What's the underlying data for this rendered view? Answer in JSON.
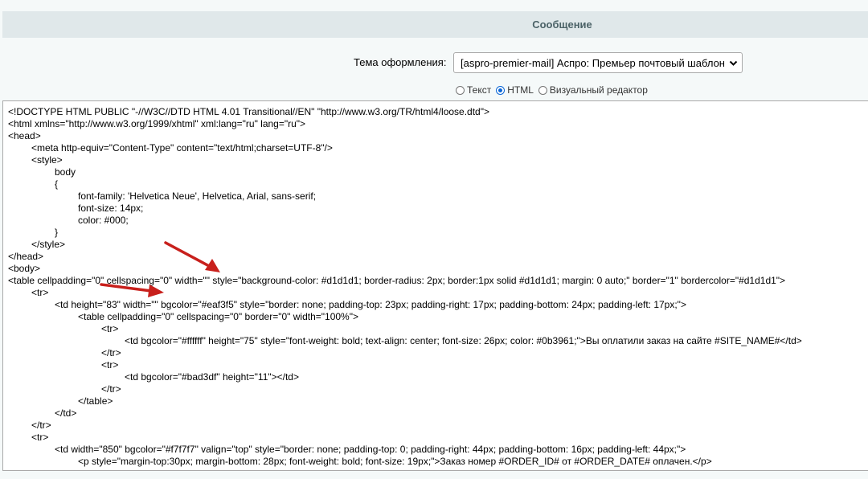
{
  "header": {
    "title": "Сообщение"
  },
  "theme": {
    "label": "Тема оформления:",
    "selected": "[aspro-premier-mail] Аспро: Премьер почтовый шаблон"
  },
  "modes": [
    {
      "label": "Текст",
      "checked": false
    },
    {
      "label": "HTML",
      "checked": true
    },
    {
      "label": "Визуальный редактор",
      "checked": false
    }
  ],
  "editor": {
    "lines": [
      "<!DOCTYPE HTML PUBLIC \"-//W3C//DTD HTML 4.01 Transitional//EN\" \"http://www.w3.org/TR/html4/loose.dtd\">",
      "<html xmlns=\"http://www.w3.org/1999/xhtml\" xml:lang=\"ru\" lang=\"ru\">",
      "<head>",
      "\t<meta http-equiv=\"Content-Type\" content=\"text/html;charset=UTF-8\"/>",
      "\t<style>",
      "\t\tbody",
      "\t\t{",
      "\t\t\tfont-family: 'Helvetica Neue', Helvetica, Arial, sans-serif;",
      "\t\t\tfont-size: 14px;",
      "\t\t\tcolor: #000;",
      "\t\t}",
      "\t</style>",
      "</head>",
      "<body>",
      "<table cellpadding=\"0\" cellspacing=\"0\" width=\"\" style=\"background-color: #d1d1d1; border-radius: 2px; border:1px solid #d1d1d1; margin: 0 auto;\" border=\"1\" bordercolor=\"#d1d1d1\">",
      "\t<tr>",
      "\t\t<td height=\"83\" width=\"\" bgcolor=\"#eaf3f5\" style=\"border: none; padding-top: 23px; padding-right: 17px; padding-bottom: 24px; padding-left: 17px;\">",
      "\t\t\t<table cellpadding=\"0\" cellspacing=\"0\" border=\"0\" width=\"100%\">",
      "\t\t\t\t<tr>",
      "\t\t\t\t\t<td bgcolor=\"#ffffff\" height=\"75\" style=\"font-weight: bold; text-align: center; font-size: 26px; color: #0b3961;\">Вы оплатили заказ на сайте #SITE_NAME#</td>",
      "\t\t\t\t</tr>",
      "\t\t\t\t<tr>",
      "\t\t\t\t\t<td bgcolor=\"#bad3df\" height=\"11\"></td>",
      "\t\t\t\t</tr>",
      "\t\t\t</table>",
      "\t\t</td>",
      "\t</tr>",
      "\t<tr>",
      "\t\t<td width=\"850\" bgcolor=\"#f7f7f7\" valign=\"top\" style=\"border: none; padding-top: 0; padding-right: 44px; padding-bottom: 16px; padding-left: 44px;\">",
      "\t\t\t<p style=\"margin-top:30px; margin-bottom: 28px; font-weight: bold; font-size: 19px;\">Заказ номер #ORDER_ID# от #ORDER_DATE# оплачен.</p>"
    ]
  },
  "colors": {
    "arrow": "#c8201c",
    "radio_checked": "#0b66d6"
  }
}
